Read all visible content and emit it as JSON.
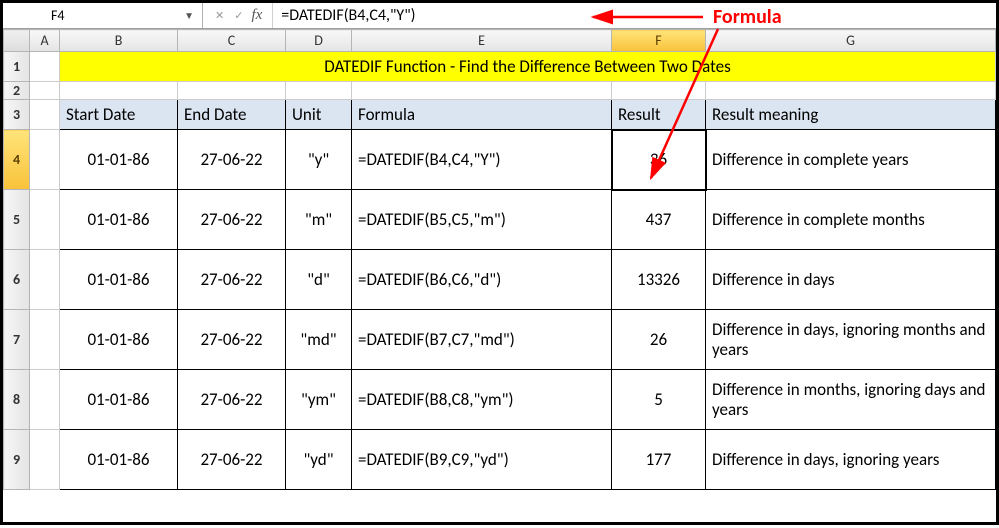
{
  "namebox": {
    "value": "F4"
  },
  "fx": {
    "label": "fx"
  },
  "formula_bar": {
    "value": "=DATEDIF(B4,C4,\"Y\")"
  },
  "annotation": {
    "label": "Formula"
  },
  "cols": {
    "A": "A",
    "B": "B",
    "C": "C",
    "D": "D",
    "E": "E",
    "F": "F",
    "G": "G"
  },
  "rows": {
    "r1": "1",
    "r2": "2",
    "r3": "3",
    "r4": "4",
    "r5": "5",
    "r6": "6",
    "r7": "7",
    "r8": "8",
    "r9": "9"
  },
  "title": "DATEDIF Function - Find the Difference Between Two Dates",
  "headers": {
    "start": "Start Date",
    "end": "End Date",
    "unit": "Unit",
    "formula": "Formula",
    "result": "Result",
    "meaning": "Result meaning"
  },
  "data": [
    {
      "start": "01-01-86",
      "end": "27-06-22",
      "unit": "\"y\"",
      "formula": "=DATEDIF(B4,C4,\"Y\")",
      "result": "36",
      "meaning": "Difference in complete years"
    },
    {
      "start": "01-01-86",
      "end": "27-06-22",
      "unit": "\"m\"",
      "formula": "=DATEDIF(B5,C5,\"m\")",
      "result": "437",
      "meaning": "Difference in complete months"
    },
    {
      "start": "01-01-86",
      "end": "27-06-22",
      "unit": "\"d\"",
      "formula": "=DATEDIF(B6,C6,\"d\")",
      "result": "13326",
      "meaning": "Difference in days"
    },
    {
      "start": "01-01-86",
      "end": "27-06-22",
      "unit": "\"md\"",
      "formula": "=DATEDIF(B7,C7,\"md\")",
      "result": "26",
      "meaning": "Difference in days, ignoring months and years"
    },
    {
      "start": "01-01-86",
      "end": "27-06-22",
      "unit": "\"ym\"",
      "formula": "=DATEDIF(B8,C8,\"ym\")",
      "result": "5",
      "meaning": "Difference in months, ignoring days and years"
    },
    {
      "start": "01-01-86",
      "end": "27-06-22",
      "unit": "\"yd\"",
      "formula": "=DATEDIF(B9,C9,\"yd\")",
      "result": "177",
      "meaning": "Difference in days, ignoring years"
    }
  ]
}
